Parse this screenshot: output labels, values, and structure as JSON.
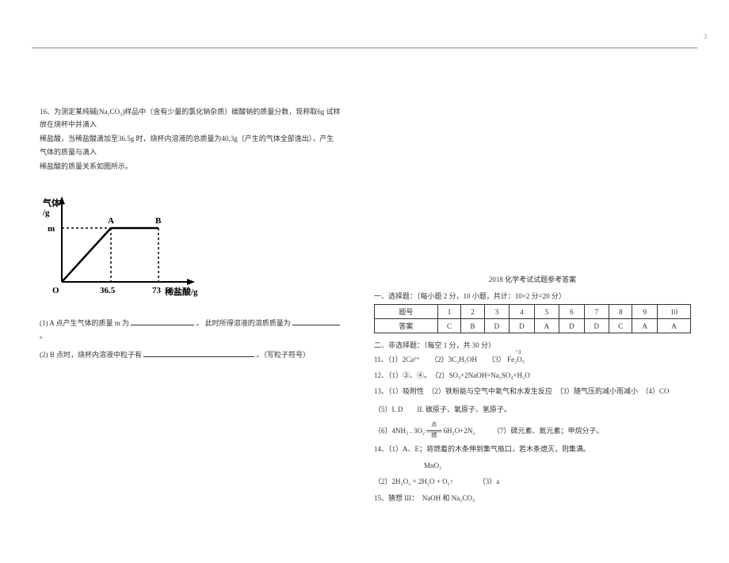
{
  "left": {
    "q16_l1": "16、为测定某纯碱(Na₂CO₃)样品中（含有少量的氯化钠杂质）碳酸钠的质量分数，现称取6g 试样放在烧杯中并滴入",
    "q16_l2": "稀盐酸，当稀盐酸滴加至36.5g 时，烧杯内溶液的总质量为40.3g（产生的气体全部逸出），产生气体的质量与滴入",
    "q16_l3": "稀盐酸的质量关系如图所示。",
    "graph": {
      "y_label_1": "气体",
      "y_label_2": "/g",
      "y_point": "m",
      "pt_A": "A",
      "pt_B": "B",
      "origin": "O",
      "x_tick1": "36.5",
      "x_tick2": "73",
      "x_label": "稀盐酸/g"
    },
    "q1_pre": "(1) A 点产生气体的质量 m 为",
    "q1_mid": "。   此时所得溶液的溶质质量为",
    "q1_end": "。",
    "q2_pre": "(2)  B 点时，烧杯内溶液中粒子有",
    "q2_end": "。（写粒子符号）"
  },
  "right": {
    "title": "2018 化学考试试题参考答案",
    "sec1": "一、选择题：（每小题  2  分，10  小题，共计：10×2  分=20  分）",
    "table": {
      "head": [
        "题号",
        "1",
        "2",
        "3",
        "4",
        "5",
        "6",
        "7",
        "8",
        "9",
        "10"
      ],
      "row": [
        "答案",
        "C",
        "B",
        "D",
        "D",
        "A",
        "D",
        "D",
        "C",
        "A",
        "A"
      ]
    },
    "sec2": "二、非选择题：（每空 1 分，共 30 分）",
    "a11": "11、（1）2Ca²⁺　　（2）3C₂H₅OH　　（3）",
    "a11_fe": "Fe₂O₃",
    "a11_fe_top": "⁺3",
    "a12": "12、（1）③、④。　（2）SO₃+2NaOH=Na₂SO₄+H₂O",
    "a13": "13、（1）吸附性　（2）铁粉能与空气中氧气和水发生反应　（3）随气压的减小而减小　（4）CO",
    "a13b": "（5）I.  D　　II.  碳原子、氧原子、氢原子。",
    "a13c_pre": "（6）4NH₃ . 3O₂",
    "a13c_top": "点燃",
    "a13c_arrow": "═══",
    "a13c_post": "6H₂O+2N₂　　　（7）硫元素、氮元素；甲烷分子。",
    "a14": "14、（1）A、E；将燃着的木条伸到集气瓶口，若木条熄灭，则集满。",
    "a14b": "　　　　　　　MnO₂",
    "a14c": "（2）2H₂O₂  =  2H₂O + O₂↑　　　　（3）a",
    "a15": "15、猜想 III：　NaOH 和 Na₂CO₃"
  },
  "chart_data": {
    "type": "line",
    "title": "产生气体的质量与滴入稀盐酸的质量关系",
    "xlabel": "稀盐酸/g",
    "ylabel": "气体/g",
    "series": [
      {
        "name": "气体质量",
        "x": [
          0,
          36.5,
          73
        ],
        "y": [
          0,
          "m",
          "m"
        ]
      }
    ],
    "annotations": [
      {
        "label": "A",
        "x": 36.5,
        "y": "m"
      },
      {
        "label": "B",
        "x": 73,
        "y": "m"
      }
    ],
    "x_ticks": [
      36.5,
      73
    ],
    "y_ticks": [
      "m"
    ]
  },
  "page_no": "3"
}
